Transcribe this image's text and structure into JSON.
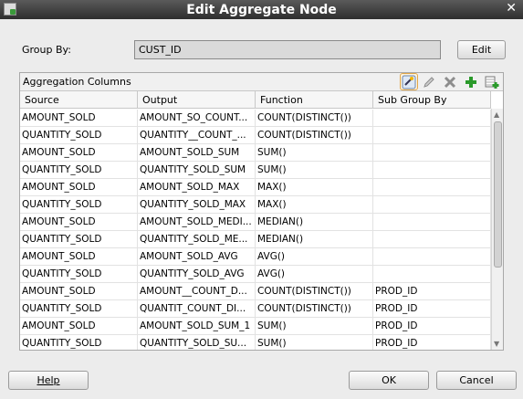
{
  "title": "Edit Aggregate Node",
  "close_glyph": "✕",
  "group_by": {
    "label": "Group By:",
    "value": "CUST_ID",
    "edit_label": "Edit"
  },
  "panel": {
    "title": "Aggregation Columns",
    "columns": [
      "Source",
      "Output",
      "Function",
      "Sub Group By"
    ],
    "rows": [
      [
        "AMOUNT_SOLD",
        "AMOUNT_SO_COUNT...",
        "COUNT(DISTINCT())",
        ""
      ],
      [
        "QUANTITY_SOLD",
        "QUANTITY__COUNT_...",
        "COUNT(DISTINCT())",
        ""
      ],
      [
        "AMOUNT_SOLD",
        "AMOUNT_SOLD_SUM",
        "SUM()",
        ""
      ],
      [
        "QUANTITY_SOLD",
        "QUANTITY_SOLD_SUM",
        "SUM()",
        ""
      ],
      [
        "AMOUNT_SOLD",
        "AMOUNT_SOLD_MAX",
        "MAX()",
        ""
      ],
      [
        "QUANTITY_SOLD",
        "QUANTITY_SOLD_MAX",
        "MAX()",
        ""
      ],
      [
        "AMOUNT_SOLD",
        "AMOUNT_SOLD_MEDI...",
        "MEDIAN()",
        ""
      ],
      [
        "QUANTITY_SOLD",
        "QUANTITY_SOLD_ME...",
        "MEDIAN()",
        ""
      ],
      [
        "AMOUNT_SOLD",
        "AMOUNT_SOLD_AVG",
        "AVG()",
        ""
      ],
      [
        "QUANTITY_SOLD",
        "QUANTITY_SOLD_AVG",
        "AVG()",
        ""
      ],
      [
        "AMOUNT_SOLD",
        "AMOUNT__COUNT_D...",
        "COUNT(DISTINCT())",
        "PROD_ID"
      ],
      [
        "QUANTITY_SOLD",
        "QUANTIT_COUNT_DI...",
        "COUNT(DISTINCT())",
        "PROD_ID"
      ],
      [
        "AMOUNT_SOLD",
        "AMOUNT_SOLD_SUM_1",
        "SUM()",
        "PROD_ID"
      ],
      [
        "QUANTITY_SOLD",
        "QUANTITY_SOLD_SU...",
        "SUM()",
        "PROD_ID"
      ]
    ],
    "toolbar": [
      "wizard-icon",
      "pencil-icon",
      "delete-icon",
      "add-icon",
      "add-table-icon"
    ]
  },
  "buttons": {
    "help": "Help",
    "ok": "OK",
    "cancel": "Cancel"
  },
  "colors": {
    "titlebar": "#3a3a3a",
    "add": "#2a9a2a",
    "selected_tool": "#e0a64a"
  }
}
